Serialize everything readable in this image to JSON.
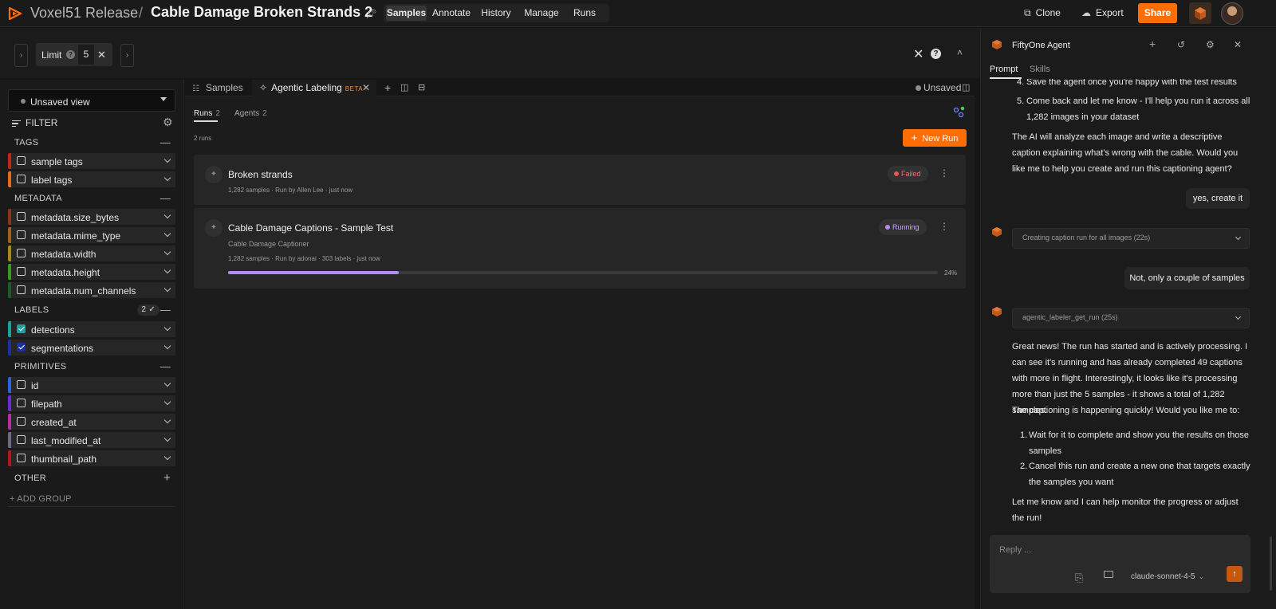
{
  "topbar": {
    "org": "Voxel51 Release",
    "separator": "/",
    "dataset": "Cable Damage Broken Strands 2",
    "nav": [
      "Samples",
      "Annotate",
      "History",
      "Manage",
      "Runs"
    ],
    "nav_active": "Samples",
    "clone_label": "Clone",
    "export_label": "Export",
    "share_label": "Share",
    "brand_color": "#ff6d04"
  },
  "viewbar": {
    "limit_label": "Limit",
    "limit_value": "5"
  },
  "sidebar": {
    "view_select": "Unsaved view",
    "filter_label": "FILTER",
    "groups": {
      "tags": "TAGS",
      "metadata": "METADATA",
      "labels": "LABELS",
      "labels_badge": "2",
      "primitives": "PRIMITIVES",
      "other": "OTHER"
    },
    "tags": [
      {
        "label": "sample tags",
        "color": "#c1261a",
        "checked": false
      },
      {
        "label": "label tags",
        "color": "#e8691a",
        "checked": false
      }
    ],
    "metadata": [
      {
        "label": "metadata.size_bytes",
        "color": "#8a3515",
        "checked": false
      },
      {
        "label": "metadata.mime_type",
        "color": "#a36019",
        "checked": false
      },
      {
        "label": "metadata.width",
        "color": "#a98a14",
        "checked": false
      },
      {
        "label": "metadata.height",
        "color": "#3b9a1f",
        "checked": false
      },
      {
        "label": "metadata.num_channels",
        "color": "#1d5d24",
        "checked": false
      }
    ],
    "labels": [
      {
        "label": "detections",
        "color": "#1aa39a",
        "checked": true,
        "check_color": "#1aa39a"
      },
      {
        "label": "segmentations",
        "color": "#1b2fa0",
        "checked": true,
        "check_color": "#1b2fa0"
      }
    ],
    "primitives": [
      {
        "label": "id",
        "color": "#2a64d8",
        "checked": false
      },
      {
        "label": "filepath",
        "color": "#6a2bd8",
        "checked": false
      },
      {
        "label": "created_at",
        "color": "#b52fa0",
        "checked": false
      },
      {
        "label": "last_modified_at",
        "color": "#6b6b86",
        "checked": false
      },
      {
        "label": "thumbnail_path",
        "color": "#b4161b",
        "checked": false
      }
    ],
    "add_group": "+ ADD GROUP"
  },
  "main": {
    "tabs": {
      "samples": "Samples",
      "agentic": "Agentic Labeling",
      "beta": "BETA"
    },
    "unsaved": "Unsaved",
    "subtabs": {
      "runs": "Runs",
      "runs_count": "2",
      "agents": "Agents",
      "agents_count": "2"
    },
    "run_count_text": "2 runs",
    "new_run_label": "New Run",
    "runs": [
      {
        "title": "Broken strands",
        "meta": "1,282 samples · Run by Allen Lee · just now",
        "status": "Failed",
        "status_color": "#ef5350"
      },
      {
        "title": "Cable Damage Captions - Sample Test",
        "subtitle": "Cable Damage Captioner",
        "meta": "1,282 samples · Run by adonai · 303 labels · just now",
        "status": "Running",
        "status_color": "#b58af1",
        "progress": 0.24,
        "progress_label": "24%"
      }
    ]
  },
  "agent": {
    "title": "FiftyOne Agent",
    "tabs": [
      "Prompt",
      "Skills"
    ],
    "step4": "Save the agent once you're happy with the test results",
    "step4_n": "4.",
    "step5": "Come back and let me know - I'll help you run it across all 1,282 images in your dataset",
    "step5_n": "5.",
    "msg1": "The AI will analyze each image and write a descriptive caption explaining what's wrong with the cable. Would you like me to help you create and run this captioning agent?",
    "user1": "yes, create it",
    "tool1": "Creating caption run for all images (22s)",
    "user2": "Not, only a couple of samples",
    "tool2": "agentic_labeler_get_run (25s)",
    "msg2": "Great news! The run has started and is actively processing. I can see it's running and has already completed 49 captions with more in flight. Interestingly, it looks like it's processing more than just the 5 samples - it shows a total of 1,282 samples.",
    "msg3": "The captioning is happening quickly! Would you like me to:",
    "opt1_n": "1.",
    "opt1": "Wait for it to complete and show you the results on those samples",
    "opt2_n": "2.",
    "opt2": "Cancel this run and create a new one that targets exactly the samples you want",
    "msg4": "Let me know and I can help monitor the progress or adjust the run!",
    "reply_placeholder": "Reply ...",
    "model": "claude-sonnet-4-5"
  }
}
